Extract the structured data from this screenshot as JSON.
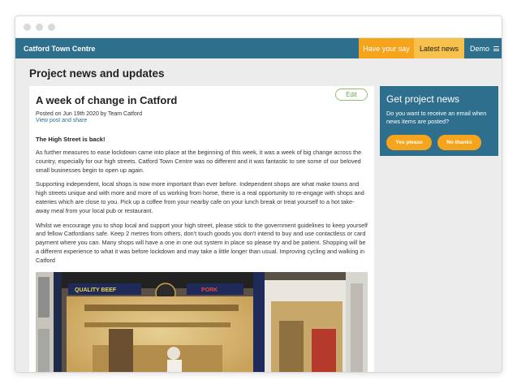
{
  "nav": {
    "brand": "Catford Town Centre",
    "have_your_say": "Have your say",
    "latest_news": "Latest news",
    "demo": "Demo"
  },
  "page": {
    "title": "Project news and updates"
  },
  "article": {
    "title": "A week of change in Catford",
    "edit_label": "Edit",
    "meta": "Posted on Jun 19th 2020 by Team Catford",
    "view_link": "View post and share",
    "subhead": "The High Street is back!",
    "paragraphs": [
      "As further measures to ease lockdown came into place at the beginning of this week, it was a week of big change across the country, especially for our high streets. Catford Town Centre was no different and it was fantastic to see some of our beloved small businesses begin to open up again.",
      "Supporting independent, local shops is now more important than ever before. Independent shops are what make towns and high streets unique and with more and more of us working from home, there is a real opportunity to re-engage with shops and eateries which are close to you. Pick up a coffee from your nearby cafe on your lunch break or treat yourself to a hot take-away meal from your local pub or restaurant.",
      "Whilst we encourage you to shop local and support your high street, please stick to the government guidelines to keep yourself and fellow Catfordians safe. Keep 2 metres from others, don't touch goods you don't intend to buy and use contactless or card payment where you can. Many shops will have a one in one out system in place so please try and be patient. Shopping will be a different experience to what it was before lockdown and may take a little longer than usual. Improving cycling and walking in Catford"
    ],
    "photo_signs": [
      "QUALITY BEEF",
      "PORK"
    ]
  },
  "sidebar": {
    "title": "Get project news",
    "text": "Do you want to receive an email when news items are posted?",
    "yes_label": "Yes please",
    "no_label": "No thanks"
  },
  "colors": {
    "nav_bg": "#2e6f8e",
    "accent_orange": "#f7a41d",
    "accent_yellow": "#f6c04b",
    "edit_green": "#6aa84f"
  }
}
